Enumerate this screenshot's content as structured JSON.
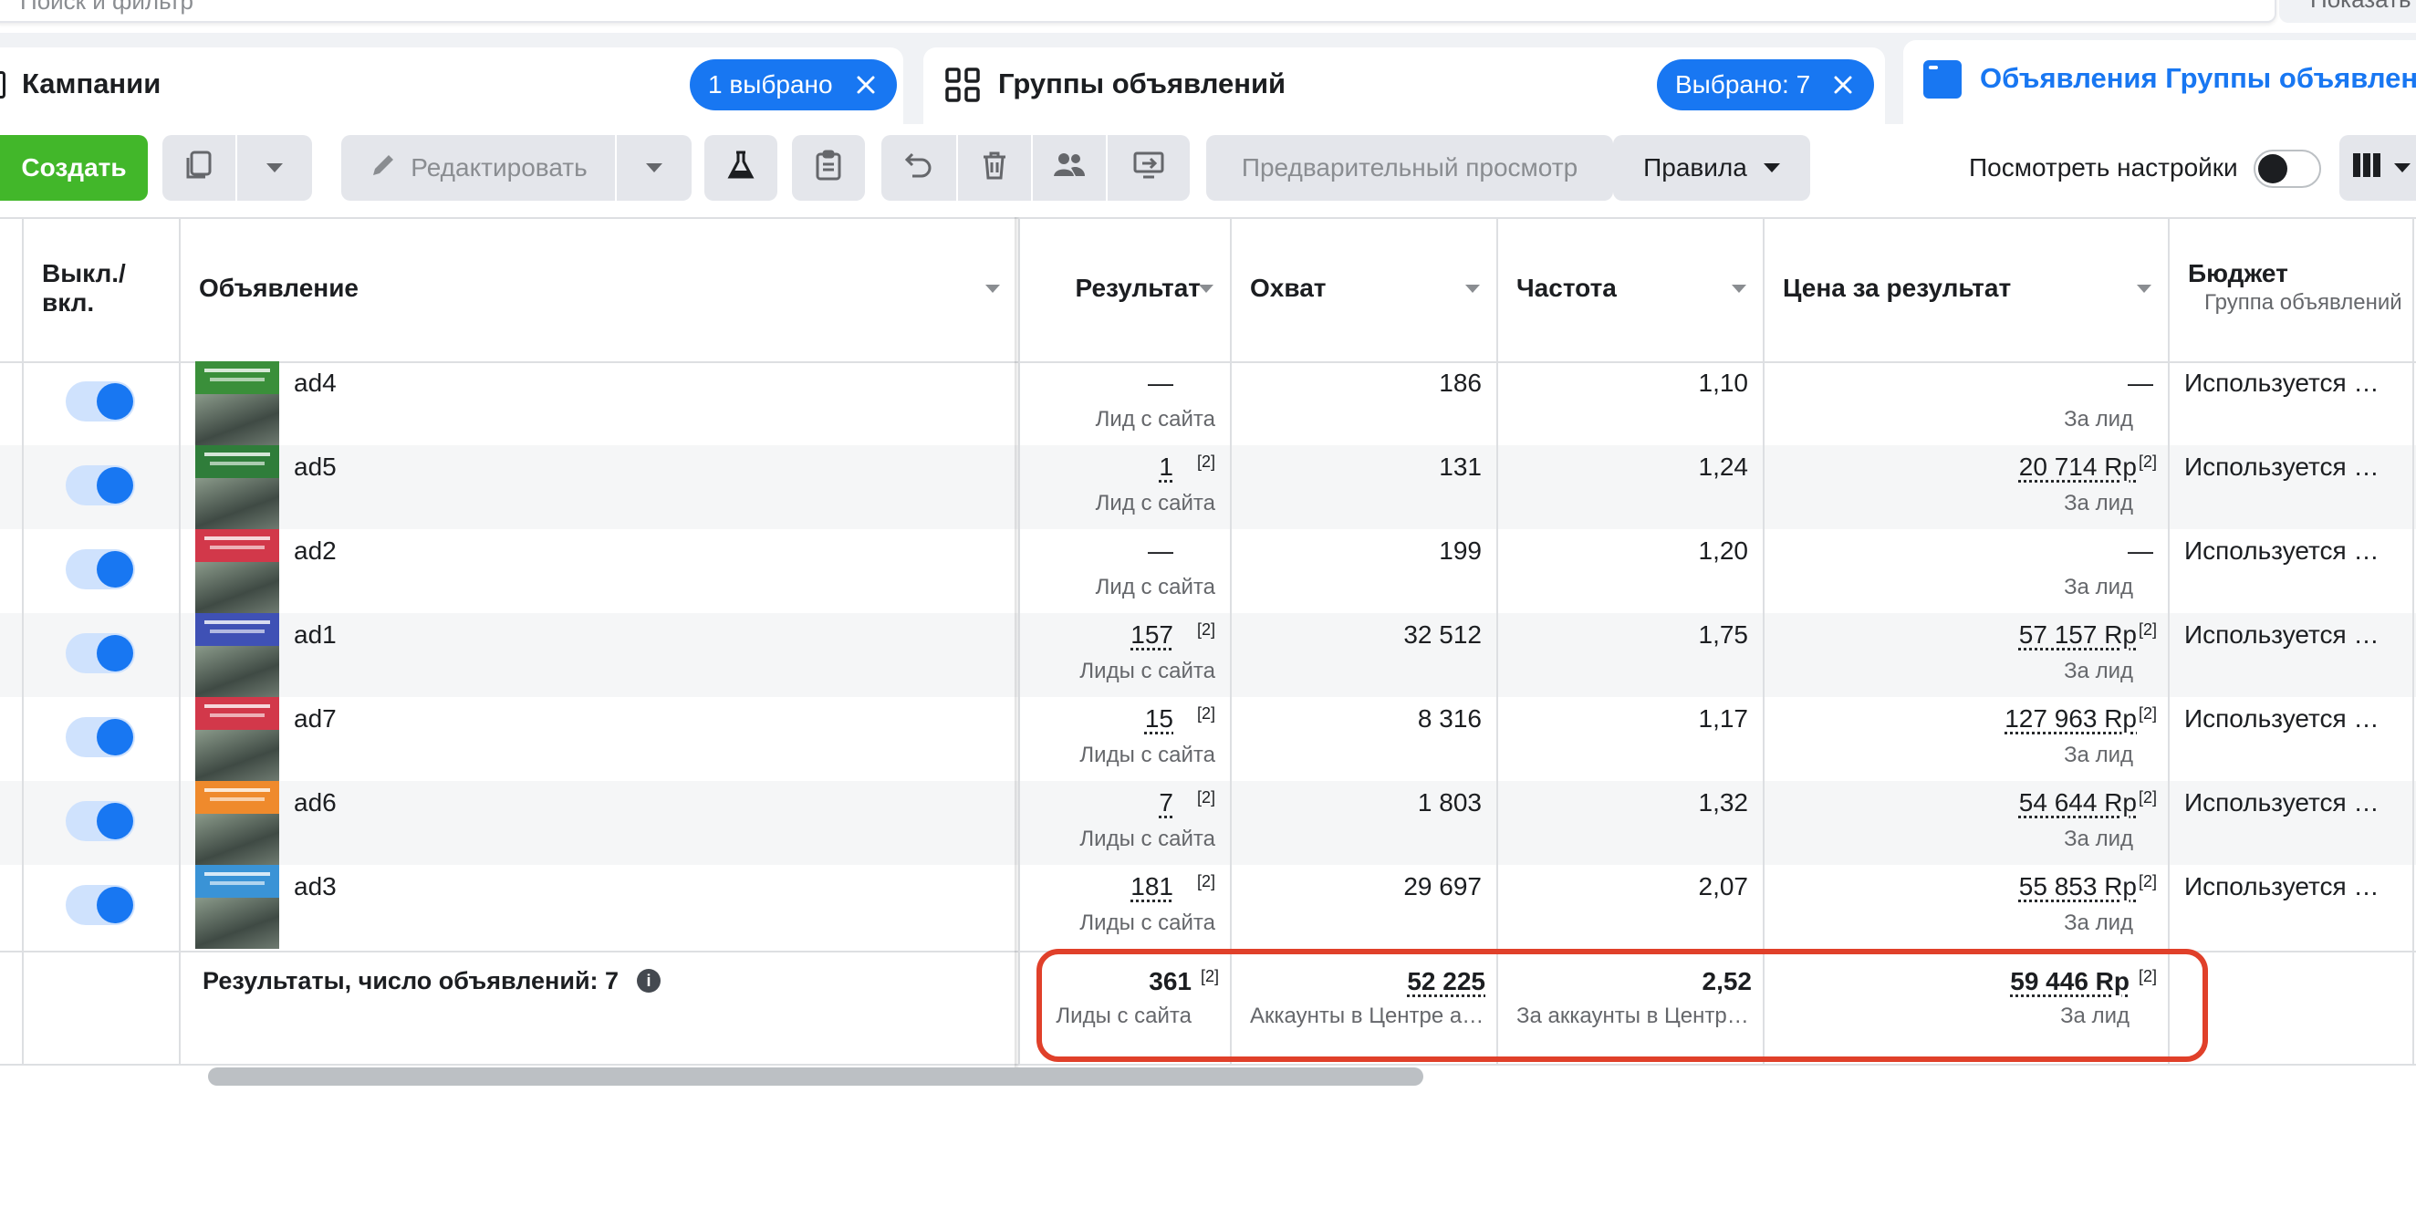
{
  "filter": {
    "placeholder": "Поиск и фильтр",
    "right_label": "Показать"
  },
  "tabs": [
    {
      "label": "Кампании",
      "badge": "1 выбрано"
    },
    {
      "label": "Группы объявлений",
      "badge": "Выбрано: 7"
    },
    {
      "label": "Объявления Группы объявлений"
    }
  ],
  "toolbar": {
    "create": "Создать",
    "edit": "Редактировать",
    "preview": "Предварительный просмотр",
    "rules": "Правила",
    "view_settings": "Посмотреть настройки"
  },
  "columns": {
    "toggle": "Выкл./\nвкл.",
    "ad": "Объявление",
    "result": "Результат",
    "reach": "Охват",
    "frequency": "Частота",
    "cost": "Цена за результат",
    "budget": "Бюджет",
    "budget_sub": "Группа объявлений"
  },
  "rows": [
    {
      "name": "ad4",
      "result": "—",
      "result_note": "",
      "result_sub": "Лид с сайта",
      "reach": "186",
      "frequency": "1,10",
      "cost": "—",
      "cost_note": "",
      "cost_sub": "За лид",
      "budget": "Используется бюджет группы объявлений",
      "thumb_color": "#3a8f3a"
    },
    {
      "name": "ad5",
      "result": "1",
      "result_note": "[2]",
      "result_sub": "Лид с сайта",
      "reach": "131",
      "frequency": "1,24",
      "cost": "20 714 Rp",
      "cost_note": "[2]",
      "cost_sub": "За лид",
      "budget": "Используется бюджет группы объявлений",
      "thumb_color": "#2f7d3a"
    },
    {
      "name": "ad2",
      "result": "—",
      "result_note": "",
      "result_sub": "Лид с сайта",
      "reach": "199",
      "frequency": "1,20",
      "cost": "—",
      "cost_note": "",
      "cost_sub": "За лид",
      "budget": "Используется бюджет группы объявлений",
      "thumb_color": "#d2384a"
    },
    {
      "name": "ad1",
      "result": "157",
      "result_note": "[2]",
      "result_sub": "Лиды с сайта",
      "reach": "32 512",
      "frequency": "1,75",
      "cost": "57 157 Rp",
      "cost_note": "[2]",
      "cost_sub": "За лид",
      "budget": "Используется бюджет группы объявлений",
      "thumb_color": "#3f51b5"
    },
    {
      "name": "ad7",
      "result": "15",
      "result_note": "[2]",
      "result_sub": "Лиды с сайта",
      "reach": "8 316",
      "frequency": "1,17",
      "cost": "127 963 Rp",
      "cost_note": "[2]",
      "cost_sub": "За лид",
      "budget": "Используется бюджет группы объявлений",
      "thumb_color": "#d2384a"
    },
    {
      "name": "ad6",
      "result": "7",
      "result_note": "[2]",
      "result_sub": "Лиды с сайта",
      "reach": "1 803",
      "frequency": "1,32",
      "cost": "54 644 Rp",
      "cost_note": "[2]",
      "cost_sub": "За лид",
      "budget": "Используется бюджет группы объявлений",
      "thumb_color": "#ef8a2c"
    },
    {
      "name": "ad3",
      "result": "181",
      "result_note": "[2]",
      "result_sub": "Лиды с сайта",
      "reach": "29 697",
      "frequency": "2,07",
      "cost": "55 853 Rp",
      "cost_note": "[2]",
      "cost_sub": "За лид",
      "budget": "Используется бюджет группы объявлений",
      "thumb_color": "#3a93d6"
    }
  ],
  "summary": {
    "label": "Результаты, число объявлений: 7",
    "result": "361",
    "result_note": "[2]",
    "result_sub": "Лиды с сайта",
    "reach": "52 225",
    "reach_sub": "Аккаунты в Центре аккаунтов",
    "frequency": "2,52",
    "frequency_sub": "За аккаунты в Центре аккаунтов",
    "cost": "59 446 Rp",
    "cost_note": "[2]",
    "cost_sub": "За лид"
  },
  "colors": {
    "accent": "#1877f2",
    "create": "#42b72a",
    "highlight": "#e0402a"
  }
}
